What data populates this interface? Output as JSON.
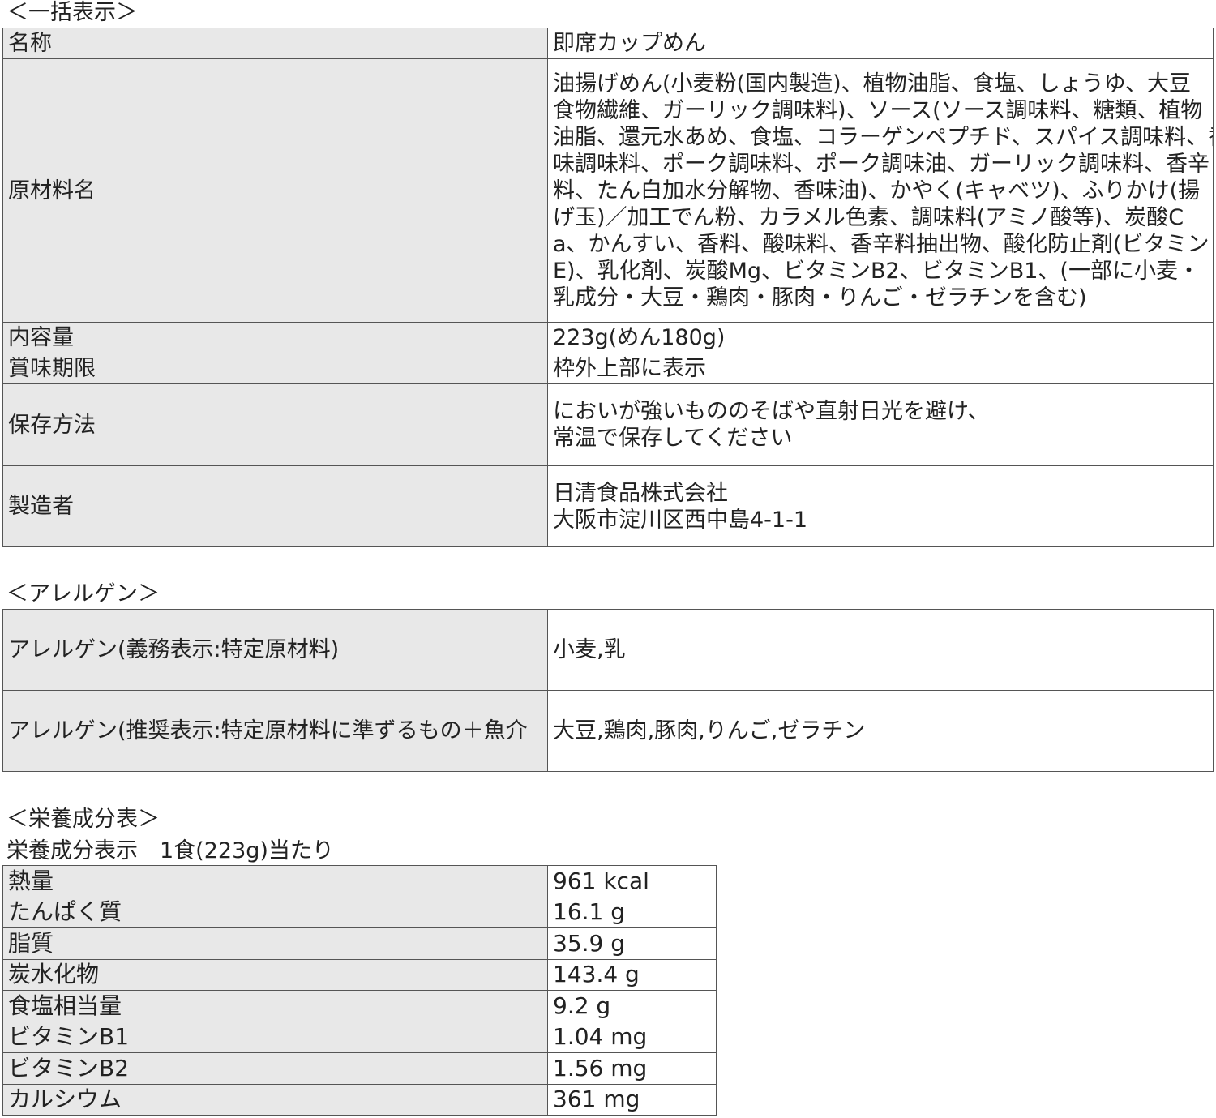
{
  "summary": {
    "heading": "＜一括表示＞",
    "rows": [
      {
        "label": "名称",
        "value_lines": [
          "即席カップめん"
        ]
      },
      {
        "label": "原材料名",
        "value_lines": [
          "油揚げめん(小麦粉(国内製造)、植物油脂、食塩、しょうゆ、大豆",
          "食物繊維、ガーリック調味料)、ソース(ソース調味料、糖類、植物",
          "油脂、還元水あめ、食塩、コラーゲンペプチド、スパイス調味料、香",
          "味調味料、ポーク調味料、ポーク調味油、ガーリック調味料、香辛",
          "料、たん白加水分解物、香味油)、かやく(キャベツ)、ふりかけ(揚",
          "げ玉)／加工でん粉、カラメル色素、調味料(アミノ酸等)、炭酸C",
          "a、かんすい、香料、酸味料、香辛料抽出物、酸化防止剤(ビタミン",
          "E)、乳化剤、炭酸Mg、ビタミンB2、ビタミンB1、(一部に小麦・",
          "乳成分・大豆・鶏肉・豚肉・りんご・ゼラチンを含む)"
        ]
      },
      {
        "label": "内容量",
        "value_lines": [
          "223g(めん180g)"
        ]
      },
      {
        "label": "賞味期限",
        "value_lines": [
          "枠外上部に表示"
        ]
      },
      {
        "label": "保存方法",
        "value_lines": [
          "においが強いもののそばや直射日光を避け、",
          "常温で保存してください"
        ]
      },
      {
        "label": "製造者",
        "value_lines": [
          "日清食品株式会社",
          "大阪市淀川区西中島4-1-1"
        ]
      }
    ]
  },
  "allergen": {
    "heading": "＜アレルゲン＞",
    "rows": [
      {
        "label": "アレルゲン(義務表示:特定原材料)",
        "value": "小麦,乳"
      },
      {
        "label": "アレルゲン(推奨表示:特定原材料に準ずるもの＋魚介",
        "value": "大豆,鶏肉,豚肉,りんご,ゼラチン"
      }
    ]
  },
  "nutrition": {
    "heading": "＜栄養成分表＞",
    "subtitle": "栄養成分表示　1食(223g)当たり",
    "rows": [
      {
        "label": "熱量",
        "value": "961 kcal"
      },
      {
        "label": "たんぱく質",
        "value": "16.1 g"
      },
      {
        "label": "脂質",
        "value": "35.9 g"
      },
      {
        "label": "炭水化物",
        "value": "143.4 g"
      },
      {
        "label": "食塩相当量",
        "value": "9.2 g"
      },
      {
        "label": "ビタミンB1",
        "value": "1.04 mg"
      },
      {
        "label": "ビタミンB2",
        "value": "1.56 mg"
      },
      {
        "label": "カルシウム",
        "value": "361 mg"
      }
    ]
  }
}
